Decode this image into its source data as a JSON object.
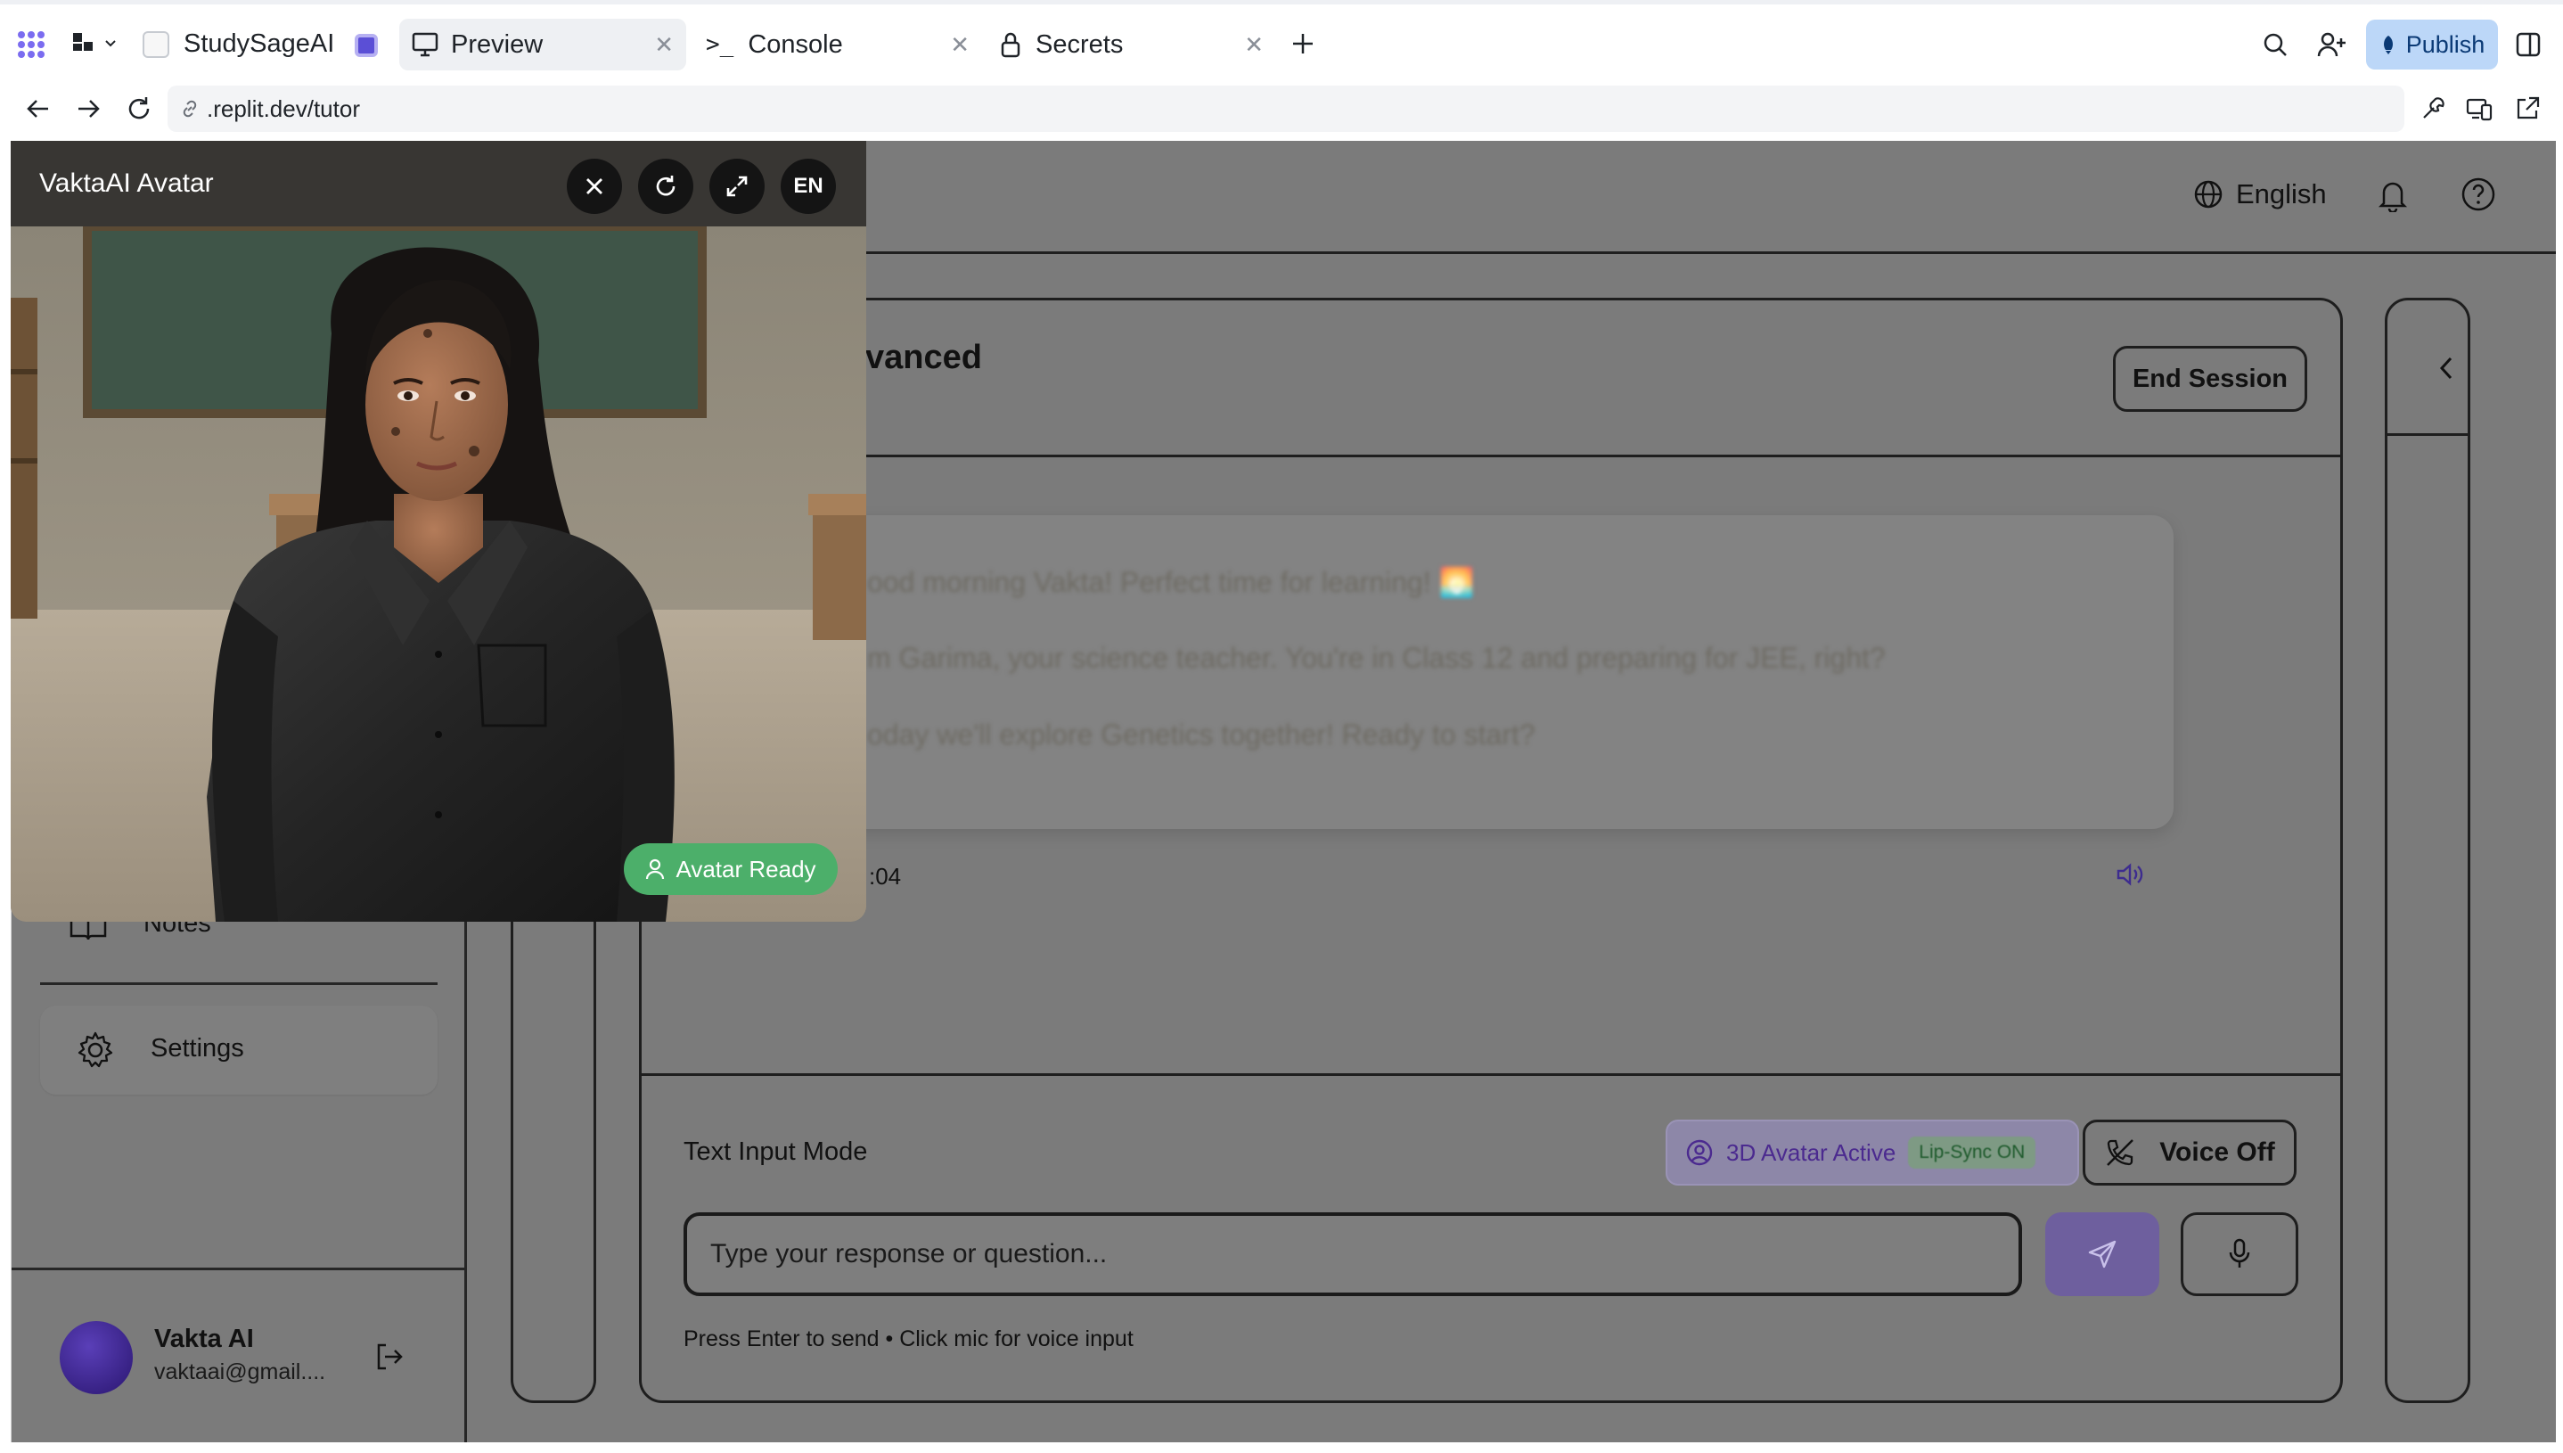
{
  "replit": {
    "project_name": "StudySageAI",
    "tabs": [
      {
        "label": "Preview",
        "active": true
      },
      {
        "label": "Console",
        "active": false
      },
      {
        "label": "Secrets",
        "active": false
      }
    ],
    "publish_label": "Publish",
    "url": ".replit.dev/tutor"
  },
  "app": {
    "language_label": "English",
    "session_title_partial": "vanced",
    "end_session_label": "End Session",
    "messages": [
      "ood morning Vakta! Perfect time for learning! 🌅",
      "m Garima, your science teacher. You're in Class 12 and preparing for JEE, right?",
      "oday we'll explore Genetics together! Ready to start?"
    ],
    "message_time_partial": ":04",
    "sidebar": {
      "notes_label": "Notes",
      "settings_label": "Settings",
      "user_name": "Vakta AI",
      "user_email": "vaktaai@gmail...."
    },
    "input_mode_label": "Text Input Mode",
    "avatar_status_label": "3D Avatar Active",
    "lipsync_label": "Lip-Sync ON",
    "voice_toggle_label": "Voice Off",
    "input_placeholder": "Type your response or question...",
    "input_hint": "Press Enter to send • Click mic for voice input"
  },
  "avatar_panel": {
    "title": "VaktaAI Avatar",
    "language_code": "EN",
    "status_label": "Avatar Ready"
  },
  "colors": {
    "publish_bg": "#bcd7f8",
    "avatar_ready": "#4caf6a",
    "send_button": "#6e5f9e",
    "overlay_dim": "#7b7b7b"
  }
}
